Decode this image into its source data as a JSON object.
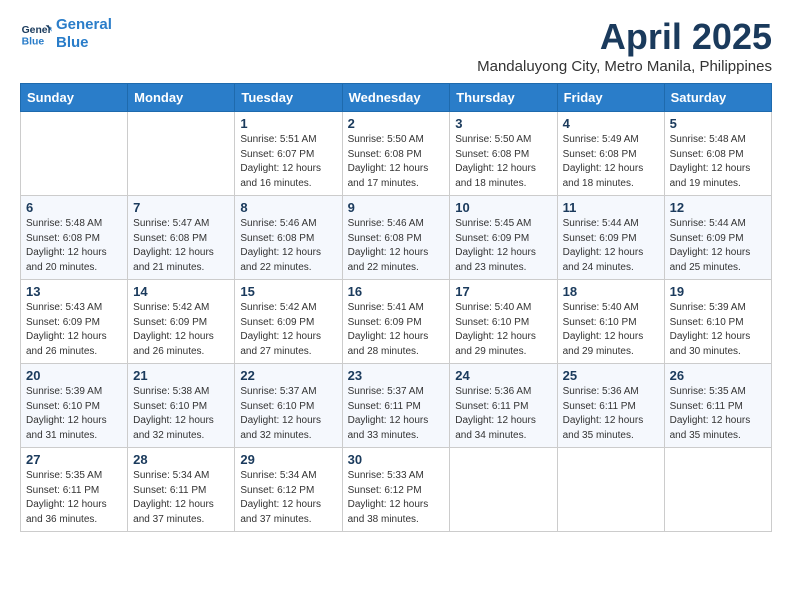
{
  "logo": {
    "line1": "General",
    "line2": "Blue"
  },
  "title": "April 2025",
  "location": "Mandaluyong City, Metro Manila, Philippines",
  "headers": [
    "Sunday",
    "Monday",
    "Tuesday",
    "Wednesday",
    "Thursday",
    "Friday",
    "Saturday"
  ],
  "weeks": [
    [
      {
        "day": "",
        "info": ""
      },
      {
        "day": "",
        "info": ""
      },
      {
        "day": "1",
        "info": "Sunrise: 5:51 AM\nSunset: 6:07 PM\nDaylight: 12 hours and 16 minutes."
      },
      {
        "day": "2",
        "info": "Sunrise: 5:50 AM\nSunset: 6:08 PM\nDaylight: 12 hours and 17 minutes."
      },
      {
        "day": "3",
        "info": "Sunrise: 5:50 AM\nSunset: 6:08 PM\nDaylight: 12 hours and 18 minutes."
      },
      {
        "day": "4",
        "info": "Sunrise: 5:49 AM\nSunset: 6:08 PM\nDaylight: 12 hours and 18 minutes."
      },
      {
        "day": "5",
        "info": "Sunrise: 5:48 AM\nSunset: 6:08 PM\nDaylight: 12 hours and 19 minutes."
      }
    ],
    [
      {
        "day": "6",
        "info": "Sunrise: 5:48 AM\nSunset: 6:08 PM\nDaylight: 12 hours and 20 minutes."
      },
      {
        "day": "7",
        "info": "Sunrise: 5:47 AM\nSunset: 6:08 PM\nDaylight: 12 hours and 21 minutes."
      },
      {
        "day": "8",
        "info": "Sunrise: 5:46 AM\nSunset: 6:08 PM\nDaylight: 12 hours and 22 minutes."
      },
      {
        "day": "9",
        "info": "Sunrise: 5:46 AM\nSunset: 6:08 PM\nDaylight: 12 hours and 22 minutes."
      },
      {
        "day": "10",
        "info": "Sunrise: 5:45 AM\nSunset: 6:09 PM\nDaylight: 12 hours and 23 minutes."
      },
      {
        "day": "11",
        "info": "Sunrise: 5:44 AM\nSunset: 6:09 PM\nDaylight: 12 hours and 24 minutes."
      },
      {
        "day": "12",
        "info": "Sunrise: 5:44 AM\nSunset: 6:09 PM\nDaylight: 12 hours and 25 minutes."
      }
    ],
    [
      {
        "day": "13",
        "info": "Sunrise: 5:43 AM\nSunset: 6:09 PM\nDaylight: 12 hours and 26 minutes."
      },
      {
        "day": "14",
        "info": "Sunrise: 5:42 AM\nSunset: 6:09 PM\nDaylight: 12 hours and 26 minutes."
      },
      {
        "day": "15",
        "info": "Sunrise: 5:42 AM\nSunset: 6:09 PM\nDaylight: 12 hours and 27 minutes."
      },
      {
        "day": "16",
        "info": "Sunrise: 5:41 AM\nSunset: 6:09 PM\nDaylight: 12 hours and 28 minutes."
      },
      {
        "day": "17",
        "info": "Sunrise: 5:40 AM\nSunset: 6:10 PM\nDaylight: 12 hours and 29 minutes."
      },
      {
        "day": "18",
        "info": "Sunrise: 5:40 AM\nSunset: 6:10 PM\nDaylight: 12 hours and 29 minutes."
      },
      {
        "day": "19",
        "info": "Sunrise: 5:39 AM\nSunset: 6:10 PM\nDaylight: 12 hours and 30 minutes."
      }
    ],
    [
      {
        "day": "20",
        "info": "Sunrise: 5:39 AM\nSunset: 6:10 PM\nDaylight: 12 hours and 31 minutes."
      },
      {
        "day": "21",
        "info": "Sunrise: 5:38 AM\nSunset: 6:10 PM\nDaylight: 12 hours and 32 minutes."
      },
      {
        "day": "22",
        "info": "Sunrise: 5:37 AM\nSunset: 6:10 PM\nDaylight: 12 hours and 32 minutes."
      },
      {
        "day": "23",
        "info": "Sunrise: 5:37 AM\nSunset: 6:11 PM\nDaylight: 12 hours and 33 minutes."
      },
      {
        "day": "24",
        "info": "Sunrise: 5:36 AM\nSunset: 6:11 PM\nDaylight: 12 hours and 34 minutes."
      },
      {
        "day": "25",
        "info": "Sunrise: 5:36 AM\nSunset: 6:11 PM\nDaylight: 12 hours and 35 minutes."
      },
      {
        "day": "26",
        "info": "Sunrise: 5:35 AM\nSunset: 6:11 PM\nDaylight: 12 hours and 35 minutes."
      }
    ],
    [
      {
        "day": "27",
        "info": "Sunrise: 5:35 AM\nSunset: 6:11 PM\nDaylight: 12 hours and 36 minutes."
      },
      {
        "day": "28",
        "info": "Sunrise: 5:34 AM\nSunset: 6:11 PM\nDaylight: 12 hours and 37 minutes."
      },
      {
        "day": "29",
        "info": "Sunrise: 5:34 AM\nSunset: 6:12 PM\nDaylight: 12 hours and 37 minutes."
      },
      {
        "day": "30",
        "info": "Sunrise: 5:33 AM\nSunset: 6:12 PM\nDaylight: 12 hours and 38 minutes."
      },
      {
        "day": "",
        "info": ""
      },
      {
        "day": "",
        "info": ""
      },
      {
        "day": "",
        "info": ""
      }
    ]
  ]
}
